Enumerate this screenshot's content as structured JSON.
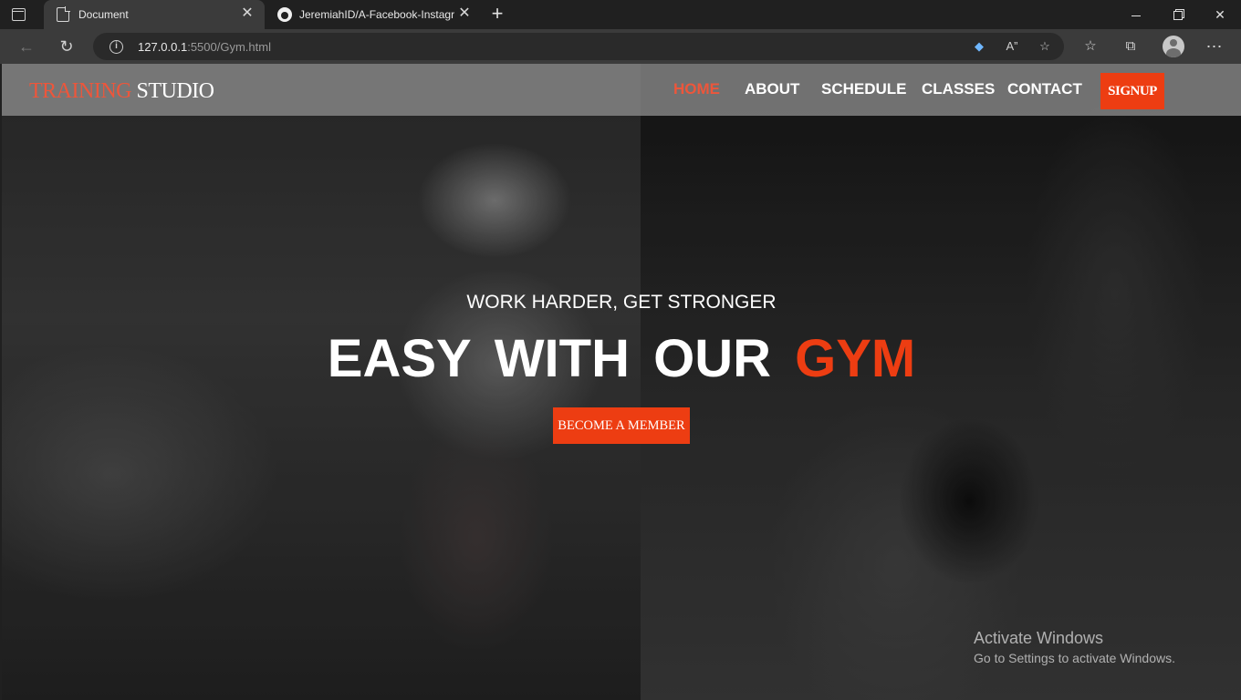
{
  "browser": {
    "tabs": [
      {
        "title": "Document",
        "active": true,
        "icon": "document-icon"
      },
      {
        "title": "JeremiahID/A-Facebook-Instagra",
        "active": false,
        "icon": "github-icon"
      }
    ],
    "new_tab_label": "+",
    "close_glyph": "✕",
    "url_host": "127.0.0.1",
    "url_rest": ":5500/Gym.html",
    "icons": [
      "tab-actions-icon",
      "back-icon",
      "reload-icon",
      "info-icon",
      "tag-icon",
      "read-aloud-icon",
      "add-favorite-icon",
      "favorites-icon",
      "collections-icon",
      "profile-icon",
      "more-icon"
    ]
  },
  "site": {
    "logo_accent": "TRAINING",
    "logo_rest": " STUDIO",
    "nav": {
      "home": "HOME",
      "about": "ABOUT",
      "schedule": "SCHEDULE",
      "classes": "CLASSES",
      "contact": "CONTACT",
      "signup": "SIGNUP"
    },
    "hero": {
      "subtitle": "WORK HARDER, GET STRONGER",
      "title_main": "EASY WITH OUR ",
      "title_accent": "GYM",
      "cta": "BECOME A MEMBER"
    },
    "colors": {
      "accent": "#ed3d12",
      "nav_active": "#ed563b"
    }
  },
  "watermark": {
    "line1": "Activate Windows",
    "line2": "Go to Settings to activate Windows."
  }
}
